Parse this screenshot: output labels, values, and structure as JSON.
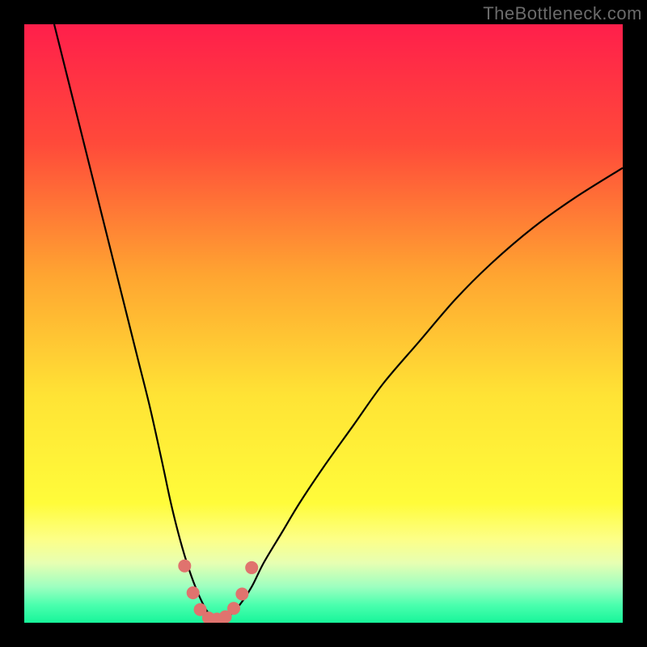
{
  "watermark": "TheBottleneck.com",
  "chart_data": {
    "type": "line",
    "title": "",
    "xlabel": "",
    "ylabel": "",
    "xlim": [
      0,
      100
    ],
    "ylim": [
      0,
      100
    ],
    "background_gradient_stops": [
      {
        "pos": 0.0,
        "color": "#ff1f4b"
      },
      {
        "pos": 0.2,
        "color": "#ff4a3a"
      },
      {
        "pos": 0.42,
        "color": "#ffa531"
      },
      {
        "pos": 0.62,
        "color": "#ffe335"
      },
      {
        "pos": 0.8,
        "color": "#fffc3a"
      },
      {
        "pos": 0.86,
        "color": "#fdff87"
      },
      {
        "pos": 0.9,
        "color": "#e7ffb2"
      },
      {
        "pos": 0.94,
        "color": "#9dffc0"
      },
      {
        "pos": 0.97,
        "color": "#4bffae"
      },
      {
        "pos": 1.0,
        "color": "#17f59a"
      }
    ],
    "series": [
      {
        "name": "bottleneck-curve",
        "color": "#000000",
        "x": [
          5,
          7,
          9,
          11,
          13,
          15,
          17,
          19,
          21,
          23,
          24.5,
          26,
          27.5,
          29,
          30.5,
          31.5,
          32.5,
          34,
          36,
          38,
          40,
          43,
          46,
          50,
          55,
          60,
          66,
          72,
          78,
          85,
          92,
          100
        ],
        "y": [
          100,
          92,
          84,
          76,
          68,
          60,
          52,
          44,
          36,
          27,
          20,
          14,
          9,
          5,
          2,
          1,
          0.5,
          1,
          3,
          6,
          10,
          15,
          20,
          26,
          33,
          40,
          47,
          54,
          60,
          66,
          71,
          76
        ]
      }
    ],
    "markers": {
      "name": "bottleneck-dots",
      "color": "#e0736e",
      "radius": 8,
      "x": [
        26.8,
        28.2,
        29.4,
        30.8,
        32.2,
        33.6,
        35.0,
        36.4,
        38.0
      ],
      "y": [
        9.5,
        5.0,
        2.2,
        0.8,
        0.6,
        1.0,
        2.4,
        4.8,
        9.2
      ]
    }
  }
}
